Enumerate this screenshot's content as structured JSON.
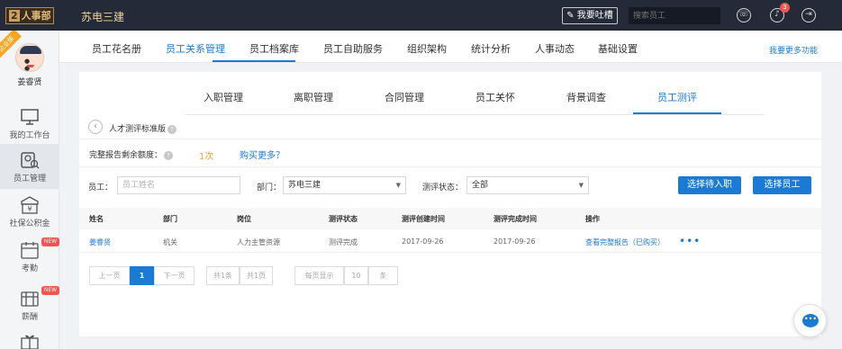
{
  "topbar": {
    "logo_number": "2",
    "logo_text": "人事部",
    "company": "苏电三建",
    "feedback_label": "我要吐槽",
    "search_placeholder": "搜索员工",
    "notification_count": "3"
  },
  "sidebar": {
    "ribbon": "企业版",
    "username": "姜睿贤",
    "items": [
      {
        "label": "我的工作台",
        "icon": "monitor-icon"
      },
      {
        "label": "员工管理",
        "icon": "employee-icon"
      },
      {
        "label": "社保公积金",
        "icon": "yen-shield-icon"
      },
      {
        "label": "考勤",
        "icon": "calendar-icon",
        "tag": "NEW"
      },
      {
        "label": "薪酬",
        "icon": "wallet-icon",
        "tag": "NEW"
      }
    ]
  },
  "mainnav": {
    "tabs": [
      "员工花名册",
      "员工关系管理",
      "员工档案库",
      "员工自助服务",
      "组织架构",
      "统计分析",
      "人事动态",
      "基础设置"
    ],
    "more": "我要更多功能"
  },
  "subnav": {
    "tabs": [
      "入职管理",
      "离职管理",
      "合同管理",
      "员工关怀",
      "背景调查",
      "员工测评"
    ]
  },
  "page": {
    "title": "人才测评标准版",
    "help": "?",
    "quota_label": "完整报告剩余额度：",
    "quota_value": "1次",
    "buy_more": "购买更多？"
  },
  "filters": {
    "employee_label": "员工：",
    "employee_placeholder": "员工姓名",
    "department_label": "部门：",
    "department_value": "苏电三建",
    "status_label": "测评状态：",
    "status_value": "全部",
    "select_pending_button": "选择待入职",
    "select_employee_button": "选择员工"
  },
  "table": {
    "headers": [
      "姓名",
      "部门",
      "岗位",
      "测评状态",
      "测评创建时间",
      "测评完成时间",
      "操作"
    ],
    "rows": [
      {
        "name": "姜睿贤",
        "department": "机关",
        "position": "人力主管资源",
        "status": "测评完成",
        "created": "2017-09-26",
        "completed": "2017-09-26",
        "action": "查看完整报告（已购买）",
        "more": "•••"
      }
    ]
  },
  "pagination": {
    "prev": "上一页",
    "current": "1",
    "next": "下一页",
    "total_items": "共1条",
    "total_pages": "共1页",
    "per_page_label": "每页显示",
    "per_page_value": "10",
    "per_page_unit": "条"
  },
  "colors": {
    "topbar": "#252a38",
    "accent": "#1b7ad3",
    "quota": "#f5a623",
    "badge": "#f25454"
  }
}
